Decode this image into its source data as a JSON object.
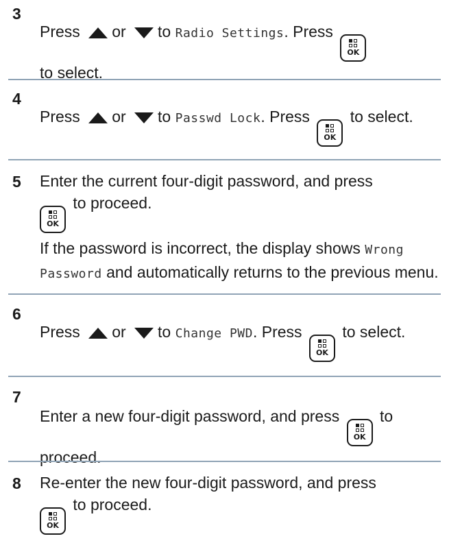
{
  "ok_key_label": "OK",
  "steps": [
    {
      "number": "3",
      "before": "Press",
      "or": "or",
      "to": "to",
      "target": "Radio Settings",
      "after_target": ". Press",
      "end": "to select."
    },
    {
      "number": "4",
      "before": "Press",
      "or": "or",
      "to": "to",
      "target": "Passwd Lock",
      "after_target": ". Press",
      "end": "to select."
    },
    {
      "number": "5",
      "text": "Enter the current four-digit password, and press",
      "end": "to proceed.",
      "note_before": "If the password is incorrect, the display shows",
      "note_code": "Wrong Password",
      "note_after": "and automatically returns to the previous menu."
    },
    {
      "number": "6",
      "before": "Press",
      "or": "or",
      "to": "to",
      "target": "Change PWD",
      "after_target": ". Press",
      "end": "to select."
    },
    {
      "number": "7",
      "text": "Enter a new four-digit password, and press",
      "end": "to proceed."
    },
    {
      "number": "8",
      "text": "Re-enter the new four-digit password, and press",
      "end": "to proceed."
    }
  ]
}
